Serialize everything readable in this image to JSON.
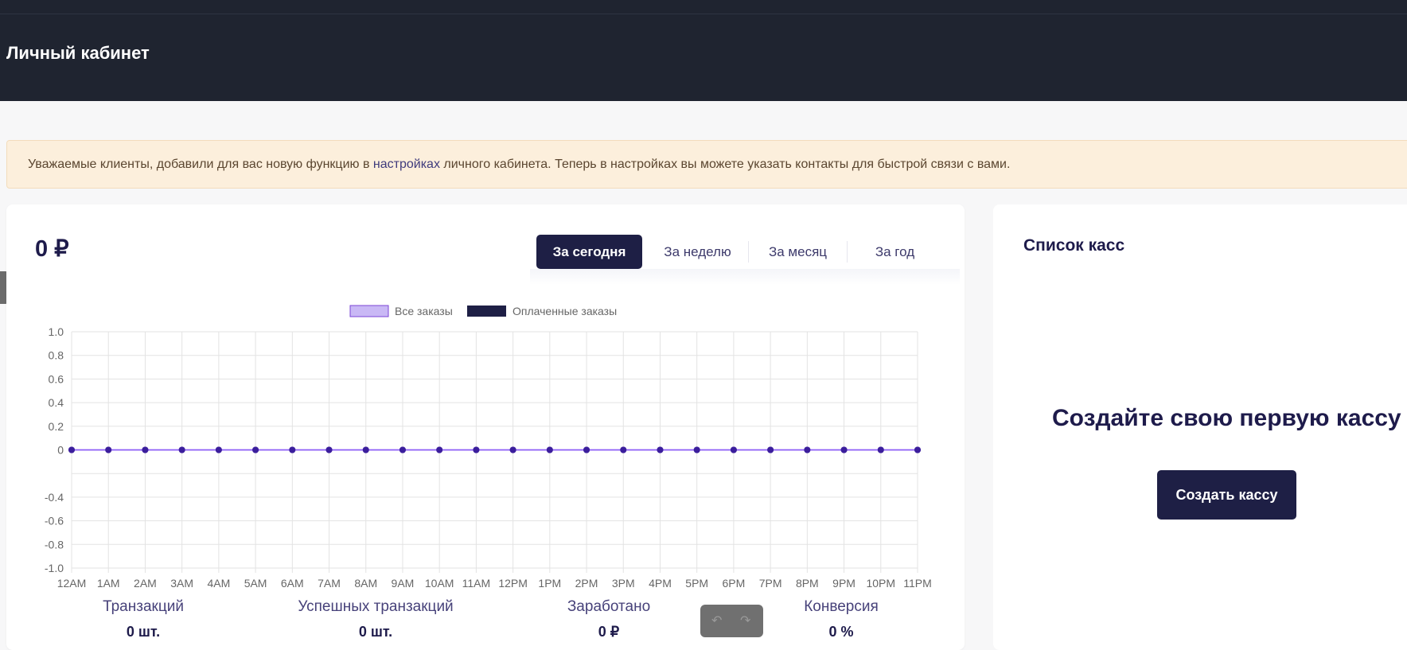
{
  "header": {
    "title": "Личный кабинет"
  },
  "notice": {
    "text_before": "Уважаемые клиенты, добавили для вас новую функцию в ",
    "link": "настройках",
    "text_after": " личного кабинета. Теперь в настройках вы можете указать контакты для быстрой связи с вами."
  },
  "summary": {
    "amount": "0 ₽"
  },
  "tabs": [
    {
      "label": "За сегодня",
      "active": true
    },
    {
      "label": "За неделю",
      "active": false
    },
    {
      "label": "За месяц",
      "active": false
    },
    {
      "label": "За год",
      "active": false
    }
  ],
  "chart_data": {
    "type": "line",
    "x": [
      "12AM",
      "1AM",
      "2AM",
      "3AM",
      "4AM",
      "5AM",
      "6AM",
      "7AM",
      "8AM",
      "9AM",
      "10AM",
      "11AM",
      "12PM",
      "1PM",
      "2PM",
      "3PM",
      "4PM",
      "5PM",
      "6PM",
      "7PM",
      "8PM",
      "9PM",
      "10PM",
      "11PM"
    ],
    "series": [
      {
        "name": "Все заказы",
        "values": [
          0,
          0,
          0,
          0,
          0,
          0,
          0,
          0,
          0,
          0,
          0,
          0,
          0,
          0,
          0,
          0,
          0,
          0,
          0,
          0,
          0,
          0,
          0,
          0
        ],
        "color": "#c9b8f5",
        "border": "#7b45d6"
      },
      {
        "name": "Оплаченные заказы",
        "values": [
          0,
          0,
          0,
          0,
          0,
          0,
          0,
          0,
          0,
          0,
          0,
          0,
          0,
          0,
          0,
          0,
          0,
          0,
          0,
          0,
          0,
          0,
          0,
          0
        ],
        "color": "#1e1f45"
      }
    ],
    "yticks": [
      "1.0",
      "0.8",
      "0.6",
      "0.4",
      "0.2",
      "0",
      "-0.4",
      "-0.6",
      "-0.8",
      "-1.0"
    ],
    "ylim": [
      -1.0,
      1.0
    ],
    "grid": true,
    "legend": "top-center",
    "line_color": "#8b5cf6",
    "point_color": "#3b1e9c"
  },
  "stats": [
    {
      "label": "Транзакций",
      "value": "0 шт."
    },
    {
      "label": "Успешных транзакций",
      "value": "0 шт."
    },
    {
      "label": "Заработано",
      "value": "0 ₽"
    },
    {
      "label": "Конверсия",
      "value": "0 %"
    }
  ],
  "kassa": {
    "title": "Список касс",
    "empty_text": "Создайте свою первую кассу",
    "create_button": "Создать кассу"
  },
  "colors": {
    "header_bg": "#1f2430",
    "accent": "#1e1f45",
    "notice_bg": "#fcefdc"
  }
}
